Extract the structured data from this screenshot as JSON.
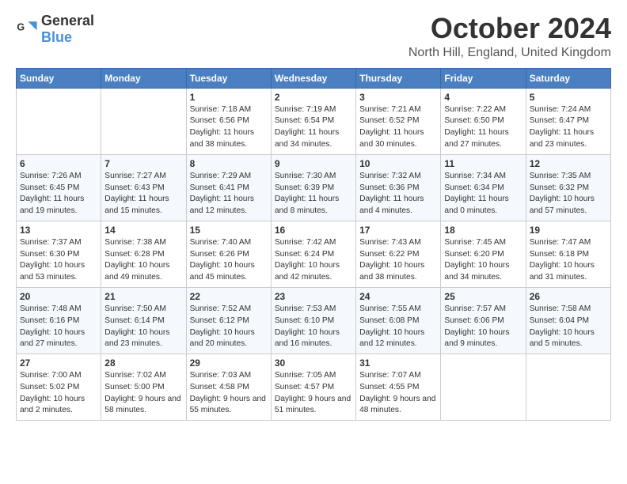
{
  "logo": {
    "general": "General",
    "blue": "Blue"
  },
  "header": {
    "month": "October 2024",
    "location": "North Hill, England, United Kingdom"
  },
  "weekdays": [
    "Sunday",
    "Monday",
    "Tuesday",
    "Wednesday",
    "Thursday",
    "Friday",
    "Saturday"
  ],
  "weeks": [
    [
      {
        "day": "",
        "info": ""
      },
      {
        "day": "",
        "info": ""
      },
      {
        "day": "1",
        "info": "Sunrise: 7:18 AM\nSunset: 6:56 PM\nDaylight: 11 hours and 38 minutes."
      },
      {
        "day": "2",
        "info": "Sunrise: 7:19 AM\nSunset: 6:54 PM\nDaylight: 11 hours and 34 minutes."
      },
      {
        "day": "3",
        "info": "Sunrise: 7:21 AM\nSunset: 6:52 PM\nDaylight: 11 hours and 30 minutes."
      },
      {
        "day": "4",
        "info": "Sunrise: 7:22 AM\nSunset: 6:50 PM\nDaylight: 11 hours and 27 minutes."
      },
      {
        "day": "5",
        "info": "Sunrise: 7:24 AM\nSunset: 6:47 PM\nDaylight: 11 hours and 23 minutes."
      }
    ],
    [
      {
        "day": "6",
        "info": "Sunrise: 7:26 AM\nSunset: 6:45 PM\nDaylight: 11 hours and 19 minutes."
      },
      {
        "day": "7",
        "info": "Sunrise: 7:27 AM\nSunset: 6:43 PM\nDaylight: 11 hours and 15 minutes."
      },
      {
        "day": "8",
        "info": "Sunrise: 7:29 AM\nSunset: 6:41 PM\nDaylight: 11 hours and 12 minutes."
      },
      {
        "day": "9",
        "info": "Sunrise: 7:30 AM\nSunset: 6:39 PM\nDaylight: 11 hours and 8 minutes."
      },
      {
        "day": "10",
        "info": "Sunrise: 7:32 AM\nSunset: 6:36 PM\nDaylight: 11 hours and 4 minutes."
      },
      {
        "day": "11",
        "info": "Sunrise: 7:34 AM\nSunset: 6:34 PM\nDaylight: 11 hours and 0 minutes."
      },
      {
        "day": "12",
        "info": "Sunrise: 7:35 AM\nSunset: 6:32 PM\nDaylight: 10 hours and 57 minutes."
      }
    ],
    [
      {
        "day": "13",
        "info": "Sunrise: 7:37 AM\nSunset: 6:30 PM\nDaylight: 10 hours and 53 minutes."
      },
      {
        "day": "14",
        "info": "Sunrise: 7:38 AM\nSunset: 6:28 PM\nDaylight: 10 hours and 49 minutes."
      },
      {
        "day": "15",
        "info": "Sunrise: 7:40 AM\nSunset: 6:26 PM\nDaylight: 10 hours and 45 minutes."
      },
      {
        "day": "16",
        "info": "Sunrise: 7:42 AM\nSunset: 6:24 PM\nDaylight: 10 hours and 42 minutes."
      },
      {
        "day": "17",
        "info": "Sunrise: 7:43 AM\nSunset: 6:22 PM\nDaylight: 10 hours and 38 minutes."
      },
      {
        "day": "18",
        "info": "Sunrise: 7:45 AM\nSunset: 6:20 PM\nDaylight: 10 hours and 34 minutes."
      },
      {
        "day": "19",
        "info": "Sunrise: 7:47 AM\nSunset: 6:18 PM\nDaylight: 10 hours and 31 minutes."
      }
    ],
    [
      {
        "day": "20",
        "info": "Sunrise: 7:48 AM\nSunset: 6:16 PM\nDaylight: 10 hours and 27 minutes."
      },
      {
        "day": "21",
        "info": "Sunrise: 7:50 AM\nSunset: 6:14 PM\nDaylight: 10 hours and 23 minutes."
      },
      {
        "day": "22",
        "info": "Sunrise: 7:52 AM\nSunset: 6:12 PM\nDaylight: 10 hours and 20 minutes."
      },
      {
        "day": "23",
        "info": "Sunrise: 7:53 AM\nSunset: 6:10 PM\nDaylight: 10 hours and 16 minutes."
      },
      {
        "day": "24",
        "info": "Sunrise: 7:55 AM\nSunset: 6:08 PM\nDaylight: 10 hours and 12 minutes."
      },
      {
        "day": "25",
        "info": "Sunrise: 7:57 AM\nSunset: 6:06 PM\nDaylight: 10 hours and 9 minutes."
      },
      {
        "day": "26",
        "info": "Sunrise: 7:58 AM\nSunset: 6:04 PM\nDaylight: 10 hours and 5 minutes."
      }
    ],
    [
      {
        "day": "27",
        "info": "Sunrise: 7:00 AM\nSunset: 5:02 PM\nDaylight: 10 hours and 2 minutes."
      },
      {
        "day": "28",
        "info": "Sunrise: 7:02 AM\nSunset: 5:00 PM\nDaylight: 9 hours and 58 minutes."
      },
      {
        "day": "29",
        "info": "Sunrise: 7:03 AM\nSunset: 4:58 PM\nDaylight: 9 hours and 55 minutes."
      },
      {
        "day": "30",
        "info": "Sunrise: 7:05 AM\nSunset: 4:57 PM\nDaylight: 9 hours and 51 minutes."
      },
      {
        "day": "31",
        "info": "Sunrise: 7:07 AM\nSunset: 4:55 PM\nDaylight: 9 hours and 48 minutes."
      },
      {
        "day": "",
        "info": ""
      },
      {
        "day": "",
        "info": ""
      }
    ]
  ]
}
